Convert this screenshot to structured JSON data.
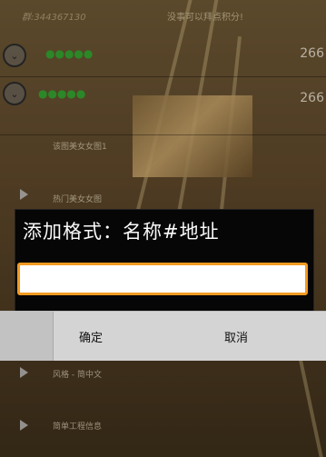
{
  "header": {
    "account_id": "群:344367130",
    "tip": "没事可以拜点积分!"
  },
  "list": {
    "rows": [
      {
        "name": "●●●●●",
        "count": "266"
      },
      {
        "name": "●●●●●",
        "count": "266"
      }
    ],
    "sub_items": [
      "该图美女女图1",
      "热门美女女图",
      "风格 - 简中文",
      "简单工程信息"
    ]
  },
  "dialog": {
    "title": "添加格式：名称#地址",
    "input_value": "",
    "ok_label": "确定",
    "cancel_label": "取消"
  },
  "colors": {
    "accent": "#f39a21",
    "dialog_bg": "#060606",
    "button_bar": "#d4d4d4"
  }
}
